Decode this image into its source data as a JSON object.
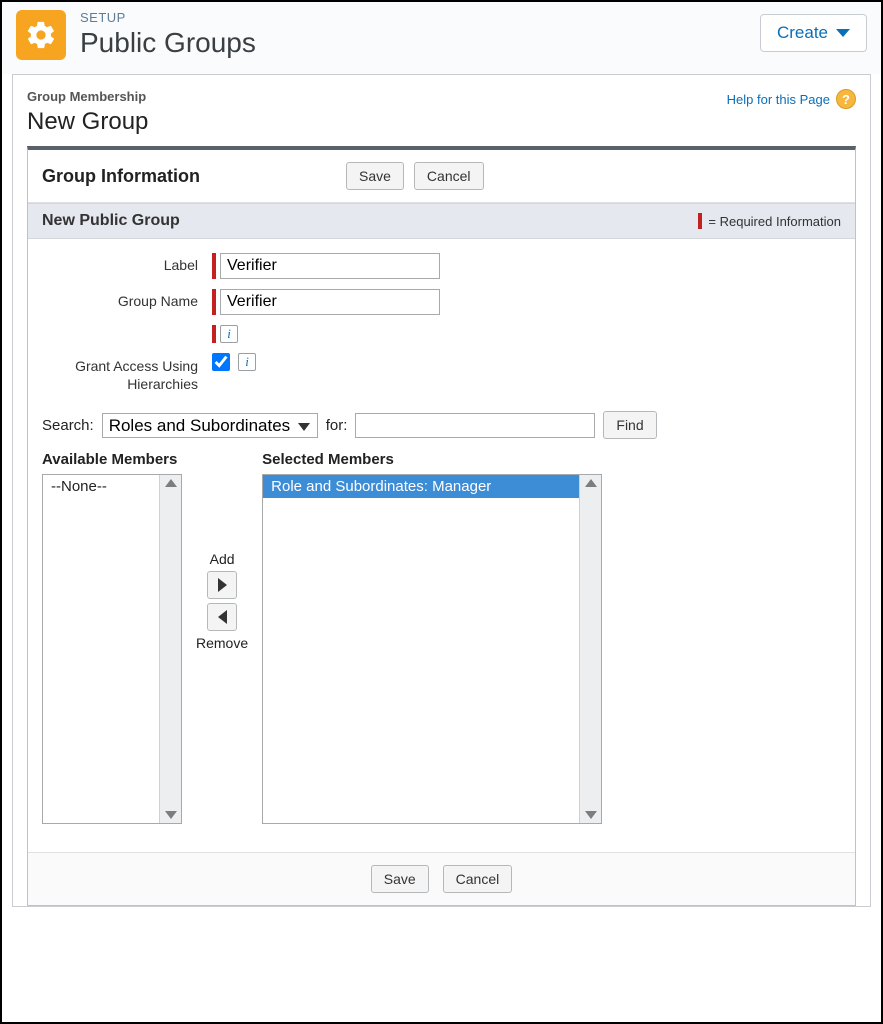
{
  "header": {
    "setup_label": "SETUP",
    "page_title": "Public Groups",
    "create_button": "Create"
  },
  "page": {
    "breadcrumb": "Group Membership",
    "section_title": "New Group",
    "help_link": "Help for this Page"
  },
  "panel": {
    "group_info_title": "Group Information",
    "save_label": "Save",
    "cancel_label": "Cancel",
    "subheader_title": "New Public Group",
    "required_info_text": "= Required Information"
  },
  "form": {
    "label_label": "Label",
    "label_value": "Verifier",
    "group_name_label": "Group Name",
    "group_name_value": "Verifier",
    "grant_access_label": "Grant Access Using Hierarchies",
    "grant_access_checked": true,
    "search_label": "Search:",
    "search_selected": "Roles and Subordinates",
    "for_label": "for:",
    "for_value": "",
    "find_label": "Find"
  },
  "dual": {
    "available_title": "Available Members",
    "available_items": [
      "--None--"
    ],
    "selected_title": "Selected Members",
    "selected_items": [
      "Role and Subordinates: Manager"
    ],
    "add_label": "Add",
    "remove_label": "Remove"
  },
  "footer": {
    "save_label": "Save",
    "cancel_label": "Cancel"
  }
}
